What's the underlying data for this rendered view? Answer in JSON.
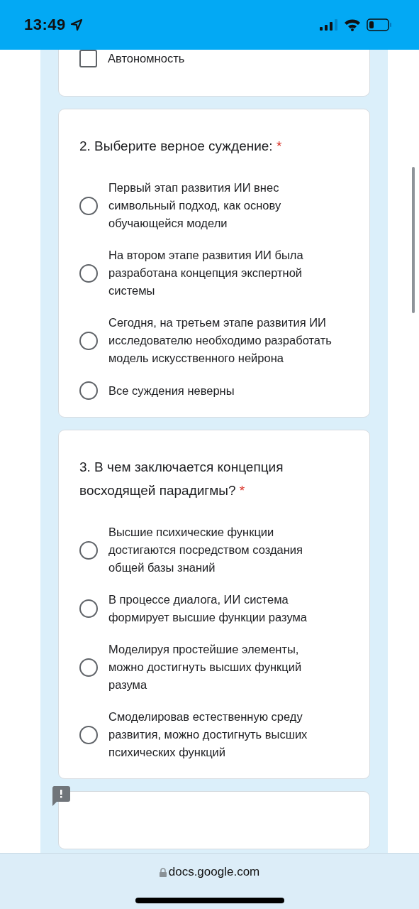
{
  "status_bar": {
    "time": "13:49"
  },
  "questions": [
    {
      "kind": "checkbox",
      "options": [
        {
          "label": "Автономность",
          "selected": false
        }
      ]
    },
    {
      "kind": "radio",
      "title": "2. Выберите верное суждение:",
      "required_mark": "*",
      "options": [
        {
          "label": "Первый этап развития ИИ внес символьный подход, как основу обучающейся модели",
          "selected": false
        },
        {
          "label": "На втором этапе развития ИИ была разработана концепция экспертной системы",
          "selected": false
        },
        {
          "label": "Сегодня, на третьем этапе развития ИИ исследователю необходимо разработать модель искусственного нейрона",
          "selected": false
        },
        {
          "label": "Все суждения неверны",
          "selected": false
        }
      ]
    },
    {
      "kind": "radio",
      "title": "3. В чем заключается концепция восходящей парадигмы?",
      "required_mark": "*",
      "options": [
        {
          "label": "Высшие психические функции достигаются посредством создания общей базы знаний",
          "selected": false
        },
        {
          "label": "В процессе диалога, ИИ система формирует высшие функции разума",
          "selected": false
        },
        {
          "label": "Моделируя простейшие элементы, можно достигнуть высших функций разума",
          "selected": false
        },
        {
          "label": "Смоделировав естественную среду развития, можно достигнуть высших психических функций",
          "selected": false
        }
      ]
    }
  ],
  "address_bar": {
    "url": "docs.google.com"
  }
}
